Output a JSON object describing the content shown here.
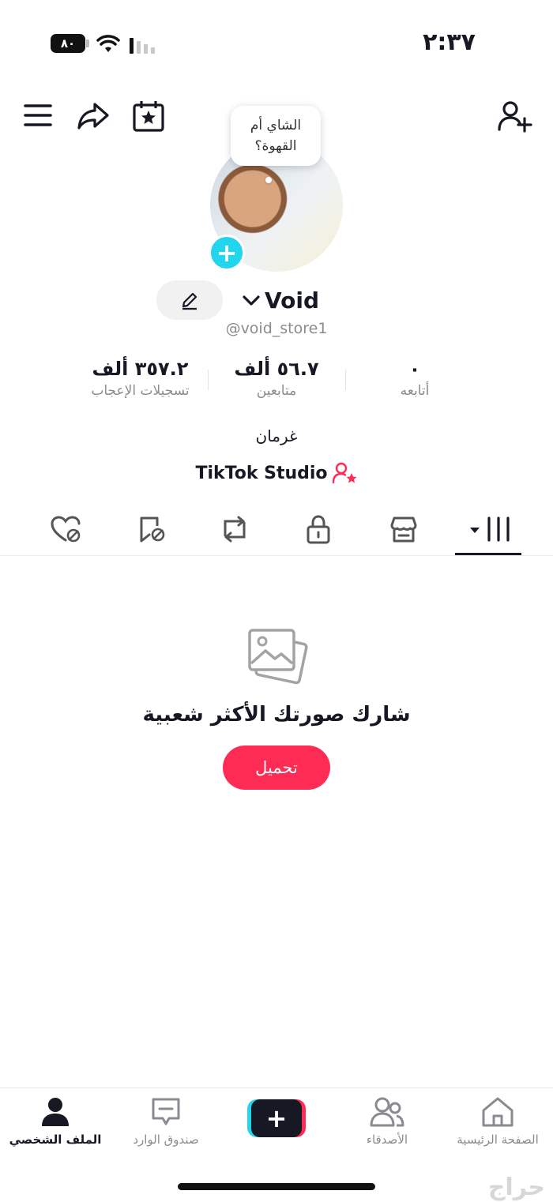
{
  "status_bar": {
    "time": "٢:٣٧",
    "battery": "٨٠"
  },
  "header": {
    "bubble_line1": "الشاي أم",
    "bubble_line2": "القهوة؟"
  },
  "profile": {
    "name": "Void",
    "handle": "@void_store1",
    "bio": "غرمان",
    "studio_label": "TikTok Studio"
  },
  "stats": [
    {
      "value": "٣٥٧.٢ ألف",
      "label": "تسجيلات الإعجاب"
    },
    {
      "value": "٥٦.٧ ألف",
      "label": "متابعين"
    },
    {
      "value": "٠",
      "label": "أتابعه"
    }
  ],
  "empty_state": {
    "title": "شارك صورتك الأكثر شعبية",
    "button": "تحميل"
  },
  "nav": {
    "profile": "الملف الشخصي",
    "inbox": "صندوق الوارد",
    "friends": "الأصدقاء",
    "home": "الصفحة الرئيسية"
  },
  "watermark": "حراج",
  "colors": {
    "accent": "#fe2c55",
    "cyan": "#20d5ec",
    "text": "#161823",
    "muted": "#8a8b91"
  }
}
